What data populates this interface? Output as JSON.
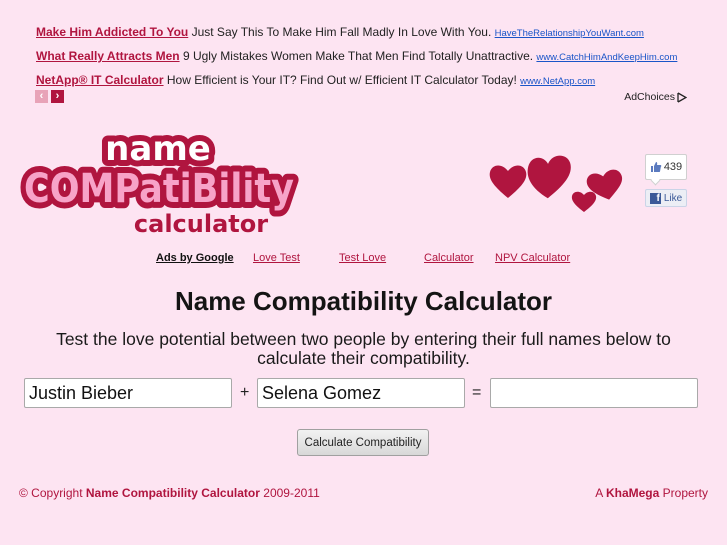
{
  "ads": [
    {
      "title": "Make Him Addicted To You",
      "text": "Just Say This To Make Him Fall Madly In Love With You.",
      "url": "HaveTheRelationshipYouWant.com"
    },
    {
      "title": "What Really Attracts Men",
      "text": "9 Ugly Mistakes Women Make That Men Find Totally Unattractive.",
      "url": "www.CatchHimAndKeepHim.com"
    },
    {
      "title": "NetApp® IT Calculator",
      "text": "How Efficient is Your IT? Find Out w/ Efficient IT Calculator Today!",
      "url": "www.NetApp.com"
    }
  ],
  "ad_nav": {
    "prev": "‹",
    "next": "›"
  },
  "adchoices_label": "AdChoices",
  "logo": {
    "line1": "name",
    "line2": "COMPatiBility",
    "line3": "calculator"
  },
  "colors": {
    "accent": "#b0153f",
    "background": "#fde4f2",
    "logo_pink": "#f7a3c8"
  },
  "facebook": {
    "count": "439",
    "like_label": "Like"
  },
  "linkbar": {
    "ads_by": "Ads by Google",
    "links": [
      "Love Test",
      "Test Love",
      "Calculator",
      "NPV Calculator"
    ]
  },
  "main": {
    "title": "Name Compatibility Calculator",
    "intro": "Test the love potential between two people by entering their full names below to calculate their compatibility.",
    "name1": "Justin Bieber",
    "name2": "Selena Gomez",
    "result": "",
    "plus": "+",
    "equals": "=",
    "button": "Calculate Compatibility"
  },
  "footer": {
    "copyright_prefix": "© Copyright",
    "site_name": "Name Compatibility Calculator",
    "years": "2009-2011",
    "property_prefix": "A",
    "company": "KhaMega",
    "property_suffix": "Property"
  }
}
